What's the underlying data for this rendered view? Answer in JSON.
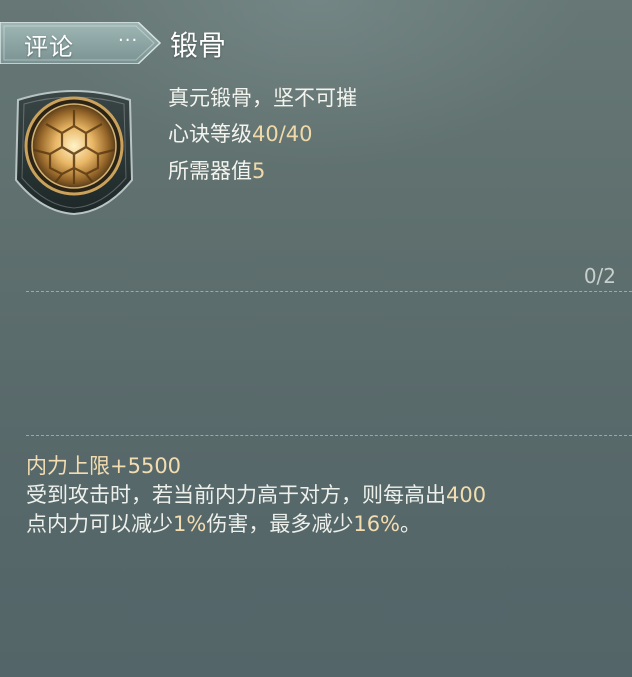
{
  "tab": {
    "label": "评论",
    "more": "···"
  },
  "skill": {
    "name": "锻骨",
    "icon": "tortoise-shell-icon",
    "description": "真元锻骨，坚不可摧",
    "level_label": "心诀等级",
    "level_value": "40/40",
    "requirement_label": "所需器值",
    "requirement_value": "5"
  },
  "progress": "0/2",
  "effect": {
    "title_label": "内力上限",
    "title_value": "+5500",
    "line1_prefix": "受到攻击时，若当前内力高于对方，则每高出",
    "line1_value": "400",
    "line2_prefix": "点内力可以减少",
    "line2_value1": "1%",
    "line2_mid": "伤害，最多减少",
    "line2_value2": "16%",
    "line2_suffix": "。"
  },
  "colors": {
    "background": "#5e6f6e",
    "highlight": "#f3ddb0",
    "tab_fill": "#8aa3a2"
  }
}
